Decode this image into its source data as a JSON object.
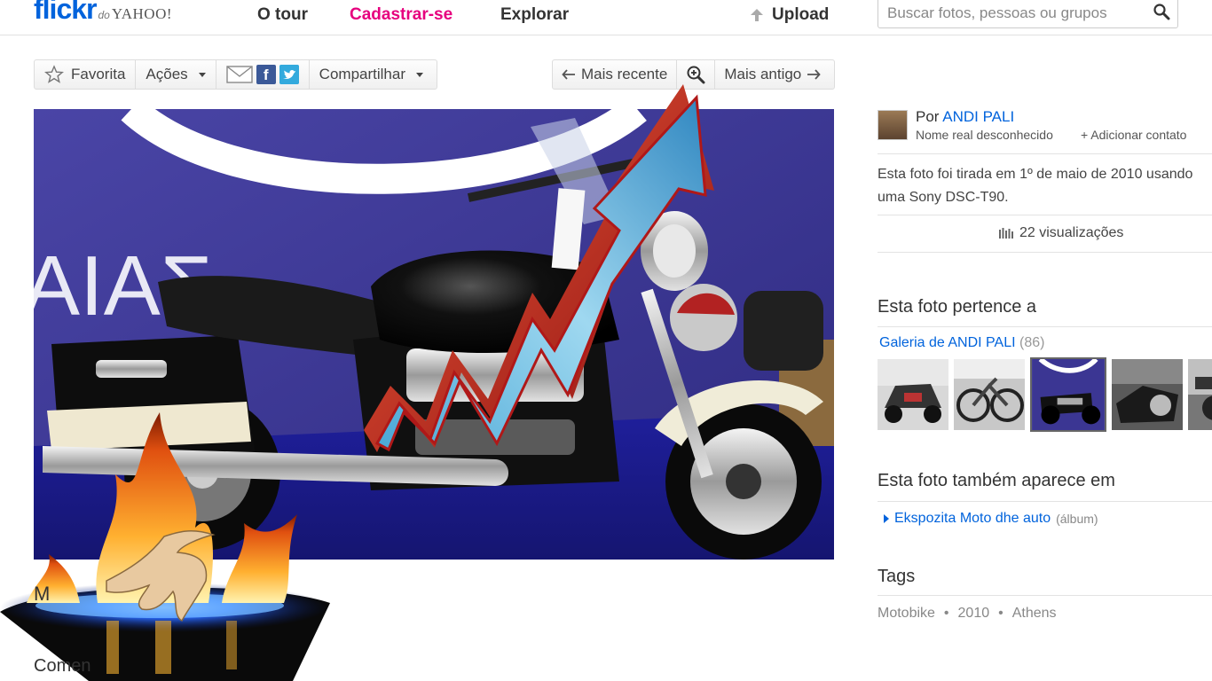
{
  "header": {
    "logo_flickr": "flickr",
    "logo_do": "do",
    "logo_yahoo": "YAHOO!",
    "nav": {
      "tour": "O tour",
      "signup": "Cadastrar-se",
      "explore": "Explorar"
    },
    "upload": "Upload",
    "search_placeholder": "Buscar fotos, pessoas ou grupos"
  },
  "toolbar": {
    "favorite": "Favorita",
    "actions": "Ações",
    "share": "Compartilhar",
    "facebook_glyph": "f"
  },
  "pager": {
    "newer": "Mais recente",
    "older": "Mais antigo"
  },
  "photo": {
    "backdrop_text": "ΑΙΑΣ",
    "overlay_icons": [
      "rising-arrow-icon",
      "fire-hand-icon"
    ]
  },
  "below_photo": {
    "title_peek": "M",
    "comments_label": "Comen"
  },
  "sidebar": {
    "owner": {
      "by_label": "Por",
      "name": "ANDI PALI",
      "real_name": "Nome real desconhecido",
      "add_contact": "+ Adicionar contato"
    },
    "taken": {
      "line1": "Esta foto foi tirada em 1º de maio de 2010 usando",
      "line2": "uma Sony DSC-T90."
    },
    "views": "22 visualizações",
    "belongs_heading": "Esta foto pertence a",
    "gallery": {
      "name": "Galeria de ANDI PALI",
      "count": "(86)"
    },
    "also_heading": "Esta foto também aparece em",
    "album": {
      "name": "Ekspozita Moto dhe auto",
      "kind": "(álbum)"
    },
    "tags_heading": "Tags",
    "tags": [
      "Motobike",
      "2010",
      "Athens"
    ],
    "tag_separator": "•"
  },
  "colors": {
    "flickr_blue": "#0063dc",
    "flickr_pink": "#e6007e",
    "link_blue": "#0063dc",
    "photo_backdrop": "#3b3693"
  }
}
